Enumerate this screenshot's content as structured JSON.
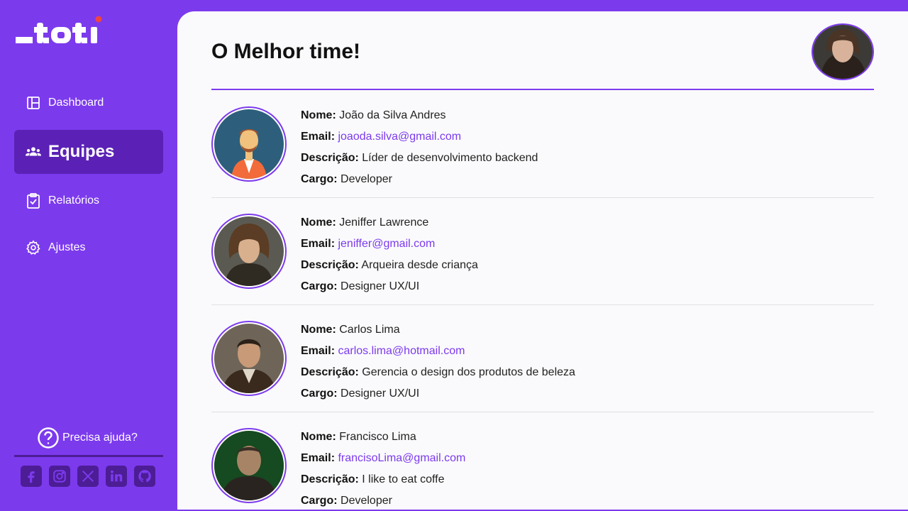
{
  "sidebar": {
    "logo_text": "_toti",
    "items": [
      {
        "label": "Dashboard",
        "icon": "layout-icon"
      },
      {
        "label": "Equipes",
        "icon": "users-icon",
        "active": true
      },
      {
        "label": "Relatórios",
        "icon": "clipboard-check-icon"
      },
      {
        "label": "Ajustes",
        "icon": "gear-icon"
      }
    ],
    "help_label": "Precisa ajuda?",
    "socials": [
      "facebook-icon",
      "instagram-icon",
      "x-icon",
      "linkedin-icon",
      "github-icon"
    ]
  },
  "main": {
    "title": "O Melhor time!",
    "labels": {
      "name": "Nome:",
      "email": "Email:",
      "description": "Descrição:",
      "role": "Cargo:"
    },
    "members": [
      {
        "name": "João da Silva Andres",
        "email": "joaoda.silva@gmail.com",
        "description": "Líder de desenvolvimento backend",
        "role": "Developer"
      },
      {
        "name": "Jeniffer Lawrence",
        "email": "jeniffer@gmail.com",
        "description": "Arqueira desde criança",
        "role": "Designer UX/UI"
      },
      {
        "name": "Carlos Lima",
        "email": "carlos.lima@hotmail.com",
        "description": "Gerencia o design dos produtos de beleza",
        "role": "Designer UX/UI"
      },
      {
        "name": "Francisco Lima",
        "email": "francisoLima@gmail.com",
        "description": "I like to eat coffe",
        "role": "Developer"
      }
    ]
  },
  "colors": {
    "brand": "#7c3aed",
    "brand_dark": "#5b21b6",
    "logo_dot": "#ef4444"
  }
}
